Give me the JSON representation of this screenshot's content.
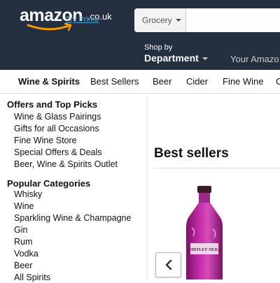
{
  "header": {
    "logo_text": "amazon",
    "logo_tld": ".co.uk",
    "try_prime": "Try Prime",
    "search": {
      "category": "Grocery",
      "placeholder": ""
    },
    "shop_by": "Shop by",
    "department": "Department",
    "your_amazon": "Your Amazo"
  },
  "subnav": {
    "items": [
      "Wine & Spirits",
      "Best Sellers",
      "Beer",
      "Cider",
      "Fine Wine",
      "C"
    ]
  },
  "leftnav": {
    "offers": {
      "title": "Offers and Top Picks",
      "links": [
        "Wine & Glass Pairings",
        "Gifts for all Occasions",
        "Fine Wine Store",
        "Special Offers & Deals",
        "Beer, Wine & Spirits Outlet"
      ]
    },
    "popular": {
      "title": "Popular Categories",
      "links": [
        "Whisky",
        "Wine",
        "Sparkling Wine & Champagne",
        "Gin",
        "Rum",
        "Vodka",
        "Beer",
        "All Spirits"
      ]
    }
  },
  "main": {
    "heading": "Best sellers",
    "product_label": "WHITLEY NEILL"
  },
  "colors": {
    "header_bg": "#232f3e",
    "prime_link": "#4aa3d9",
    "logo_smile": "#ff9900",
    "gin_pink": "#b0209a"
  }
}
